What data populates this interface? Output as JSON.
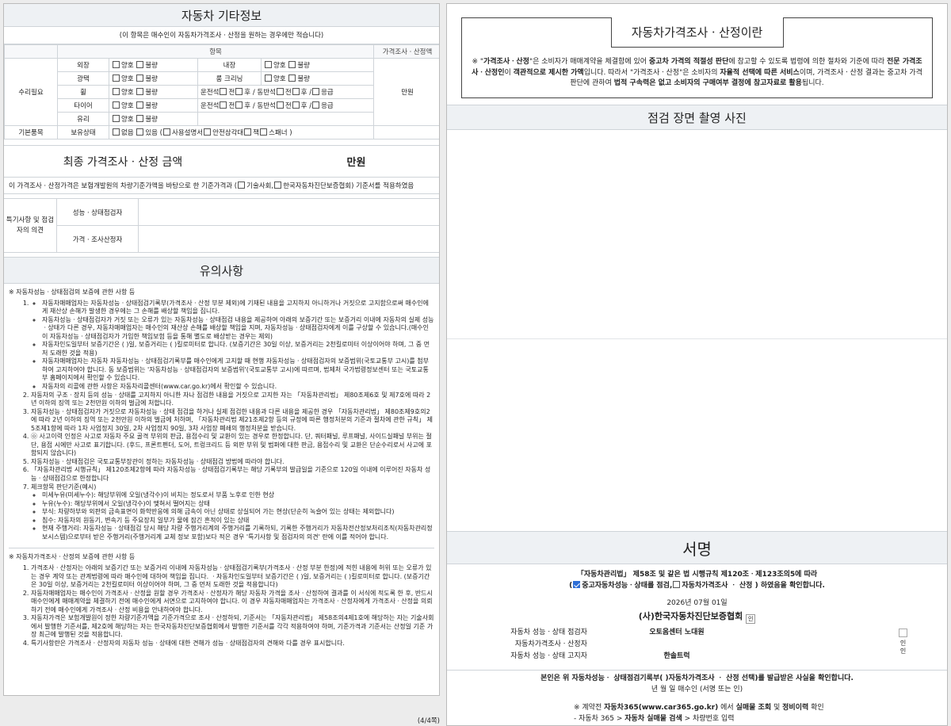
{
  "left": {
    "other_info": {
      "title": "자동차 기타정보",
      "note": "(이 항목은 매수인이 자동차가격조사ㆍ산정을 원하는 경우에만 적습니다)",
      "header_item": "항목",
      "header_price": "가격조사ㆍ산정액",
      "repair_label": "수리필요",
      "basic_label": "기본품목",
      "price_unit": "만원",
      "rows": {
        "exterior": "외장",
        "interior": "내장",
        "gloss": "광택",
        "room_cleaning": "룸 크리닝",
        "wheel": "휠",
        "tire": "타이어",
        "glass": "유리",
        "possession": "보유상태"
      },
      "good": "양호",
      "bad": "불량",
      "driver_side": "운전석",
      "passenger_side": "동반석",
      "front": "전",
      "rear": "후",
      "emergency": "응급",
      "none": "없음",
      "present": "있음 (",
      "manual": "사용설명서",
      "triangle": "안전삼각대",
      "jack": "잭",
      "spanner": "스패너 )"
    },
    "final": {
      "label": "최종 가격조사ㆍ산정 금액",
      "unit": "만원",
      "basis_pre": "이 가격조사ㆍ산정가격은 보험개발원의 차량기준가액을 바탕으로 한 기준가격과 (",
      "basis_opt1": "기술사회,",
      "basis_opt2": "한국자동차진단보증협회) 기준서를 적용하였음"
    },
    "opinion": {
      "header": "특기사항 및 점검자의 의견",
      "inspector": "성능ㆍ상태점검자",
      "appraiser": "가격ㆍ조사산정자"
    },
    "cautions": {
      "title": "유의사항",
      "section1_head": "※ 자동차성능ㆍ상태점검의 보증에 관한 사항 등",
      "item1_bullets": [
        "자동차매매업자는 자동차성능ㆍ상태점검기록부(가격조사ㆍ산정 부분 제외)에 기재된 내용을 고지하지 아니하거나 거짓으로 고지함으로써 매수인에게 재산상 손해가 발생한 경우에는 그 손해를 배상할 책임을 집니다.",
        "자동차성능ㆍ상태점검자가 거짓 또는 오류가 있는 자동차성능ㆍ상태점검 내용을 제공하여 아래의 보증기간 또는 보증거리 이내에 자동차의 실제 성능ㆍ상태가 다른 경우, 자동차매매업자는 매수인의 재산상 손해를 배상할 책임을 지며, 자동차성능ㆍ상태점검자에게 이를 구상할 수 있습니다.(매수인이 자동차성능ㆍ상태점검자가 가입한 책임보험 등을 통해 별도로 배상받는 경우는 제외)",
        "자동차인도일부터 보증기간은 (      )일, 보증거리는 (      )킬로미터로 합니다. (보증기간은 30일 이상, 보증거리는 2천킬로미터 이상이어야 하며, 그 중 먼저 도래한 것을 적용)",
        "자동차매매업자는 자동차 자동차성능ㆍ상태점검기록부를 매수인에게 고지할 때 현행 자동차성능ㆍ상태점검자의 보증범위(국토교통부 고시)를 첨부하여 고지하여야 합니다. 동 보증범위는 '자동차성능ㆍ상태점검자의 보증범위'(국토교통부 고시)에 따르며, 법제처 국가법령정보센터 또는 국토교통부 홈페이지에서 확인할 수 있습니다.",
        "자동차의 리콜에 관한 사항은 자동차리콜센터(www.car.go.kr)에서 확인할 수 있습니다."
      ],
      "section1_items": [
        "자동차의 구조ㆍ장치 등의 성능ㆍ상태를 고지하지 아니한 자나 점검한 내용을 거짓으로 고지한 자는 「자동차관리법」 제80조제6호 및 제7호에 따라 2년 이하의 징역 또는 2천만원 이하의 벌금에 처합니다.",
        "자동차성능ㆍ상태점검자가 거짓으로 자동차성능ㆍ상태 점검을 하거나 실제 점검한 내용과 다른 내용을 제공한 경우 「자동차관리법」 제80조제9호의2에 따라 2년 이하의 징역 또는 2천만원 이하의 벌금에 처하며, 「자동차관리법 제21조제2항 등의 규정에 따른 행정처분의 기준과 절차에 관한 규칙」 제5조제1항에 따라 1차 사업정지 30일, 2차 사업정지 90일, 3차 사업장 폐쇄의 행정처분을 받습니다.",
        "㉧ 사고이력 인정은 사고로 자동차 주요 골격 부위의 판금, 용접수리 및 교환이 있는 경우로 한정합니다. 단, 쿼터패널, 루프패널, 사이드실패널 부위는 절단, 용접 시에만 사고로 표기합니다. (후드, 프론트펜더, 도어, 트렁크리드 등 외판 부위 및 범퍼에 대한 판금, 용접수리 및 교환은 단순수리로서 사고에 포함되지 않습니다)",
        "자동차성능ㆍ상태점검은 국토교통부장관이 정하는 자동차성능ㆍ상태점검 방법에 따라야 합니다.",
        "「자동차관리법 시행규칙」 제120조제2항에 따라 자동차성능ㆍ상태점검기록부는 해당 기록부의 발급일을 기준으로 120일 이내에 이루어진 자동차 성능ㆍ상태점검으로 한정합니다",
        "체크항목 판단기준(예시)"
      ],
      "item7_bullets": [
        "미세누유(미세누수): 해당부위에 오일(냉각수)이 비치는 정도로서 부품 노후로 인한 현상",
        "누유(누수): 해당부위에서 오일(냉각수)이 맺혀서 떨어지는 상태",
        "부식: 차량하부와 외판의 금속표면이 화학반응에 의해 금속이 아닌 상태로 상실되어 가는 현상(단순히 녹슬어 있는 상태는 제외합니다)",
        "침수: 자동차의 원동기, 변속기 등 주요장치 일부가 물에 잠긴 흔적이 있는 상태",
        "현재 주행거리: 자동차성능ㆍ상태점검 당시 해당 차량 주행거리계의 주행거리를 기록하되, 기록한 주행거리가 자동차전산정보처리조직(자동차관리정보시스템)으로부터 받은 주행거리(주행거리계 교체 정보 포함)보다 적은 경우 '특기사항 및 점검자의 의견' 란에 이를 적어야 합니다."
      ],
      "section2_head": "※ 자동차가격조사ㆍ산정의 보증에 관한 사항 등",
      "section2_items": [
        "가격조사ㆍ산정자는 아래의 보증기간 또는 보증거리 이내에 자동차성능ㆍ상태점검기록부(가격조사ㆍ산정 부분 한정)에 적힌 내용에 허위 또는 오류가 있는 경우 계약 또는 관계법령에 따라 매수인에 대하여 책임을 집니다. ㆍ자동차인도일부터 보증기간은 (      )일, 보증거리는 (      )킬로미터로 합니다. (보증기간은 30일 이상, 보증거리는 2천킬로미터 이상이어야 하며, 그 중 먼저 도래한 것을 적용합니다)",
        "자동차매매업자는 매수인이 가격조사ㆍ산정을 원할 경우 가격조사ㆍ산정자가 해당 자동차 가격을 조사ㆍ산정하여 결과를 이 서식에 적도록 한 후, 반드시 매수인에게 매매계약을 체결하기 전에 매수인에게 서면으로 고지하여야 합니다. 이 경우 자동차매매업자는 가격조사ㆍ산정자에게 가격조사ㆍ산정을 의뢰하기 전에 매수인에게 가격조사ㆍ산정 비용을 안내하여야 합니다.",
        "자동차가격은 보험개발원이 정한 차량기준가액을 기준가격으로 조사ㆍ산정하되, 기준서는 「자동차관리법」 제58조의4제1호에 해당하는 자는 기술사회에서 발행한 기준서를, 제2호에 해당하는 자는 한국자동차진단보증협회에서 발행한 기준서를 각각 적용하여야 하며, 기준가격과 기준서는 산정일 기준 가장 최근에 발행된 것을 적용합니다.",
        "특기사항란은 가격조사ㆍ산정자의 자동차 성능ㆍ상태에 대한 견해가 성능ㆍ상태점검자의 견해와 다를 경우 표시합니다."
      ]
    },
    "page_number": "(4/4쪽)"
  },
  "right": {
    "intro": {
      "title": "자동차가격조사ㆍ산정이란",
      "text_1": "※ \"",
      "text_b1": "가격조사ㆍ산정",
      "text_2": "\"은 소비자가 매매계약을 체결함에 있어 ",
      "text_b2": "중고차 가격의 적절성 판단",
      "text_3": "에 참고할 수 있도록 법령에 의한 절차와 기준에 따라 ",
      "text_b3": "전문 가격조사ㆍ산정인",
      "text_4": "이 ",
      "text_b4": "객관적으로 제시한 가액",
      "text_5": "입니다. 따라서 \"가격조사ㆍ산정\"은 소비자의 ",
      "text_b5": "자율적 선택에 따른 서비스",
      "text_6": "이며, 가격조사ㆍ산정 결과는 중고차 가격판단에 관하여 ",
      "text_b6": "법적 구속력은 없고 소비자의 구매여부 결정에 참고자료로 활용",
      "text_7": "됩니다."
    },
    "photo_title": "점검 장면 촬영 사진",
    "sign": {
      "title": "서명",
      "law_line": "「자동차관리법」 제58조 및 같은 법 시행규칙 제120조ㆍ제123조의5에 따라",
      "check_opt1": "중고자동차성능ㆍ상태를 점검,",
      "check_opt2": "자동차가격조사 ㆍ 산정 ) 하였음을 확인합니다.",
      "date": "2026년 07월  01일",
      "association": "(사)한국자동차진단보증협회",
      "stamp_text": "인",
      "signers": [
        {
          "label": "자동차 성능ㆍ상태 점검자",
          "value": "오토옴센터 노대원"
        },
        {
          "label": "자동차가격조사ㆍ산정자",
          "value": ""
        },
        {
          "label": "자동차 성능ㆍ상태 고지자",
          "value": "한솔트럭"
        }
      ],
      "seal_text_1": "인",
      "seal_text_2": "인",
      "confirm_line": "본인은 위 자동차성능ㆍ 상태점검기록부(  )자동차가격조사 ㆍ 산정 선택)를 발급받은 사실을 확인합니다.",
      "buyer_line": "년    월    일    매수인                  (서명 또는 인)",
      "footnote1_pre": "※ 계약전 ",
      "footnote1_b1": "자동차365(www.car365.go.kr)",
      "footnote1_mid": " 에서 ",
      "footnote1_b2": "실매물 조회",
      "footnote1_and": " 및 ",
      "footnote1_b3": "정비이력",
      "footnote1_post": " 확인",
      "footnote2_pre": "- 자동차 365 > ",
      "footnote2_b": "자동차 실매물 검색",
      "footnote2_post": " > 차량번호 입력"
    }
  }
}
